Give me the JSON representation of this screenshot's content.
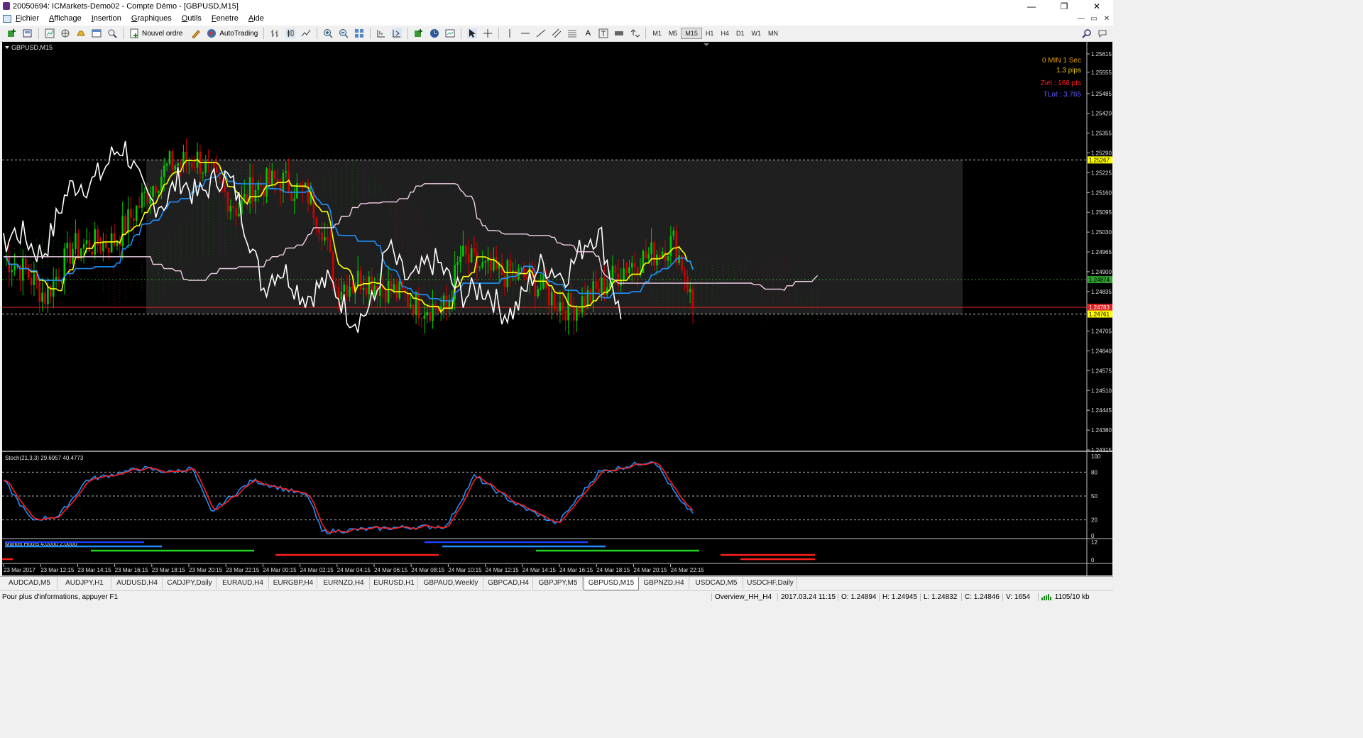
{
  "window": {
    "title": "20050694: ICMarkets-Demo02 - Compte Démo - [GBPUSD,M15]",
    "controls": [
      "—",
      "❐",
      "✕"
    ],
    "mdi_controls": [
      "—",
      "▭",
      "✕"
    ]
  },
  "menu": [
    "Fichier",
    "Affichage",
    "Insertion",
    "Graphiques",
    "Outils",
    "Fenetre",
    "Aide"
  ],
  "toolbar": {
    "new_order": "Nouvel ordre",
    "autotrading": "AutoTrading",
    "timeframes": [
      "M1",
      "M5",
      "M15",
      "H1",
      "H4",
      "D1",
      "W1",
      "MN"
    ],
    "active_timeframe": "M15"
  },
  "chart": {
    "symbol_label": "GBPUSD,M15",
    "info": {
      "countdown": "0 MIN 1 Sec",
      "spread": "1.3 pips",
      "target": "Ziel : 166 pts",
      "tlot": "TLot : 3.765"
    },
    "price_axis": [
      "1.25615",
      "1.25555",
      "1.25485",
      "1.25420",
      "1.25355",
      "1.25290",
      "1.25225",
      "1.25160",
      "1.25095",
      "1.25030",
      "1.24965",
      "1.24900",
      "1.24835",
      "1.24770",
      "1.24705",
      "1.24640",
      "1.24575",
      "1.24510",
      "1.24445",
      "1.24380",
      "1.24315"
    ],
    "level_labels": {
      "top_line": "1.25267",
      "bid": "1.24874",
      "red_line": "1.24783",
      "low_line": "1.24761"
    },
    "stoch": {
      "label": "Stoch(21,3,3) 29.6957 40.4773",
      "levels": [
        "100",
        "80",
        "50",
        "20",
        "0"
      ],
      "main_color": "#1e90ff",
      "signal_color": "#ff1e1e"
    },
    "market_hours": {
      "label": "Market Hours 4.0000 2.0000",
      "levels": [
        "12",
        "0"
      ]
    },
    "time_axis": [
      "23 Mar 2017",
      "23 Mar 12:15",
      "23 Mar 14:15",
      "23 Mar 16:15",
      "23 Mar 18:15",
      "23 Mar 20:15",
      "23 Mar 22:15",
      "24 Mar 00:15",
      "24 Mar 02:15",
      "24 Mar 04:15",
      "24 Mar 06:15",
      "24 Mar 08:15",
      "24 Mar 10:15",
      "24 Mar 12:15",
      "24 Mar 14:15",
      "24 Mar 16:15",
      "24 Mar 18:15",
      "24 Mar 20:15",
      "24 Mar 22:15"
    ],
    "colors": {
      "bull_candle": "#00c800",
      "bear_candle": "#d40000",
      "tenkan": "#ffff00",
      "kijun": "#1e90ff",
      "chikou": "#ffffff",
      "senkou_b": "#f0d0e8"
    }
  },
  "tabs": [
    "AUDCAD,M5",
    "AUDJPY,H1",
    "AUDUSD,H4",
    "CADJPY,Daily",
    "EURAUD,H4",
    "EURGBP,H4",
    "EURNZD,H4",
    "EURUSD,H1",
    "GBPAUD,Weekly",
    "GBPCAD,H4",
    "GBPJPY,M5",
    "GBPUSD,M15",
    "GBPNZD,H4",
    "USDCAD,M5",
    "USDCHF,Daily"
  ],
  "active_tab": "GBPUSD,M15",
  "status": {
    "help": "Pour plus d'informations, appuyer F1",
    "profile": "Overview_HH_H4",
    "datetime": "2017.03.24 11:15",
    "open": "O: 1.24894",
    "high": "H: 1.24945",
    "low": "L: 1.24832",
    "close": "C: 1.24846",
    "volume": "V: 1654",
    "traffic": "1105/10 kb"
  }
}
